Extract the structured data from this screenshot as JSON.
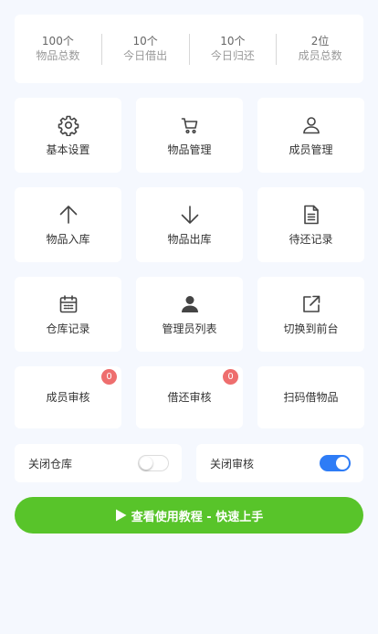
{
  "stats": [
    {
      "value": "100个",
      "label": "物品总数"
    },
    {
      "value": "10个",
      "label": "今日借出"
    },
    {
      "value": "10个",
      "label": "今日归还"
    },
    {
      "value": "2位",
      "label": "成员总数"
    }
  ],
  "menu": {
    "basic_settings": "基本设置",
    "item_management": "物品管理",
    "member_management": "成员管理",
    "stock_in": "物品入库",
    "stock_out": "物品出库",
    "pending_return": "待还记录",
    "warehouse_records": "仓库记录",
    "admin_list": "管理员列表",
    "switch_frontend": "切换到前台",
    "member_review": "成员审核",
    "member_review_badge": "0",
    "borrow_review": "借还审核",
    "borrow_review_badge": "0",
    "scan_borrow": "扫码借物品"
  },
  "toggles": {
    "close_warehouse": {
      "label": "关闭仓库",
      "on": false
    },
    "close_review": {
      "label": "关闭审核",
      "on": true
    }
  },
  "cta": {
    "label": "查看使用教程 - 快速上手"
  },
  "colors": {
    "accent_green": "#58c42a",
    "switch_on_blue": "#2e7cf6",
    "badge_red": "#ee6e6e",
    "background": "#f5f8fe"
  },
  "icons": [
    "gear-icon",
    "cart-icon",
    "user-outline-icon",
    "arrow-up-icon",
    "arrow-down-icon",
    "document-icon",
    "calendar-icon",
    "user-solid-icon",
    "external-link-icon",
    "play-icon"
  ]
}
